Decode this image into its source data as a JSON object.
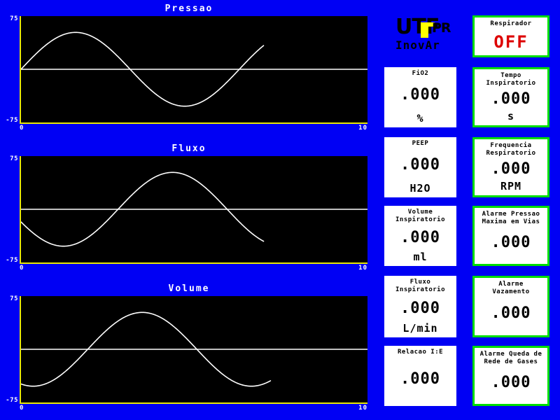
{
  "branding": {
    "logo_main": "UTF",
    "logo_suffix": "PR",
    "product_name": "InovAr"
  },
  "charts": [
    {
      "title": "Pressao",
      "ytick_top": "75",
      "ytick_bottom": "-75",
      "xtick_left": "0",
      "xtick_right": "10"
    },
    {
      "title": "Fluxo",
      "ytick_top": "75",
      "ytick_bottom": "-75",
      "xtick_left": "0",
      "xtick_right": "10"
    },
    {
      "title": "Volume",
      "ytick_top": "75",
      "ytick_bottom": "-75",
      "xtick_left": "0",
      "xtick_right": "10"
    }
  ],
  "chart_data": [
    {
      "type": "line",
      "title": "Pressao",
      "xlabel": "",
      "ylabel": "",
      "xlim": [
        0,
        10
      ],
      "ylim": [
        -75,
        75
      ],
      "grid": false,
      "zero_line": true,
      "series": [
        {
          "name": "Pressao",
          "phase_deg": 0,
          "amplitude": 52,
          "period": 6.3,
          "x_end": 7.0,
          "x": [
            0.0,
            0.35,
            0.7,
            1.05,
            1.4,
            1.75,
            2.1,
            2.45,
            2.8,
            3.15,
            3.5,
            3.85,
            4.2,
            4.55,
            4.9,
            5.25,
            5.6,
            5.95,
            6.3,
            6.65,
            7.0
          ],
          "values": [
            0,
            18,
            34,
            45,
            51,
            52,
            47,
            37,
            23,
            7,
            -10,
            -26,
            -39,
            -48,
            -52,
            -50,
            -43,
            -31,
            -16,
            2,
            20
          ]
        }
      ]
    },
    {
      "type": "line",
      "title": "Fluxo",
      "xlabel": "",
      "ylabel": "",
      "xlim": [
        0,
        10
      ],
      "ylim": [
        -75,
        75
      ],
      "grid": false,
      "zero_line": true,
      "series": [
        {
          "name": "Fluxo",
          "phase_deg": 200,
          "amplitude": 52,
          "period": 6.3,
          "x_end": 7.0,
          "x": [
            0.0,
            0.35,
            0.7,
            1.05,
            1.4,
            1.75,
            2.1,
            2.45,
            2.8,
            3.15,
            3.5,
            3.85,
            4.2,
            4.55,
            4.9,
            5.25,
            5.6,
            5.95,
            6.3,
            6.65,
            7.0
          ],
          "values": [
            -18,
            -34,
            -45,
            -51,
            -52,
            -47,
            -37,
            -23,
            -7,
            10,
            26,
            39,
            48,
            52,
            50,
            43,
            31,
            16,
            -2,
            -20,
            -34
          ]
        }
      ]
    },
    {
      "type": "line",
      "title": "Volume",
      "xlabel": "",
      "ylabel": "",
      "xlim": [
        0,
        10
      ],
      "ylim": [
        -75,
        75
      ],
      "grid": false,
      "zero_line": true,
      "series": [
        {
          "name": "Volume",
          "phase_deg": 250,
          "amplitude": 52,
          "period": 6.3,
          "x_end": 7.2,
          "x": [
            0.0,
            0.36,
            0.72,
            1.08,
            1.44,
            1.8,
            2.16,
            2.52,
            2.88,
            3.24,
            3.6,
            3.96,
            4.32,
            4.68,
            5.04,
            5.4,
            5.76,
            6.12,
            6.48,
            6.84,
            7.2
          ],
          "values": [
            -49,
            -45,
            -34,
            -18,
            1,
            20,
            36,
            47,
            52,
            51,
            43,
            29,
            12,
            -7,
            -25,
            -40,
            -49,
            -52,
            -48,
            -37,
            -20
          ]
        }
      ]
    }
  ],
  "status": {
    "respirador": {
      "label": "Respirador",
      "value": "OFF",
      "unit": ""
    }
  },
  "readouts_left": [
    {
      "label": "FiO2",
      "value": ".000",
      "unit": "%"
    },
    {
      "label": "PEEP",
      "value": ".000",
      "unit": "H2O"
    },
    {
      "label": "Volume Inspiratorio",
      "value": ".000",
      "unit": "ml"
    },
    {
      "label": "Fluxo\nInspiratorio",
      "value": ".000",
      "unit": "L/min"
    },
    {
      "label": "Relacao I:E",
      "value": ".000",
      "unit": ""
    }
  ],
  "readouts_right": [
    {
      "label": "Tempo\nInspiratorio",
      "value": ".000",
      "unit": "s"
    },
    {
      "label": "Frequencia\nRespiratorio",
      "value": ".000",
      "unit": "RPM"
    },
    {
      "label": "Alarme Pressao\nMaxima em Vias",
      "value": ".000",
      "unit": ""
    },
    {
      "label": "Alarme\nVazamento",
      "value": ".000",
      "unit": ""
    },
    {
      "label": "Alarme Queda de\nRede de Gases",
      "value": ".000",
      "unit": ""
    }
  ],
  "colors": {
    "background": "#0000F4",
    "plot_background": "#000000",
    "axis": "#E8E800",
    "trace": "#FFFFFF",
    "box_border": "#00DD00",
    "alarm_text": "#DD0000",
    "logo_accent": "#FFFF00"
  }
}
